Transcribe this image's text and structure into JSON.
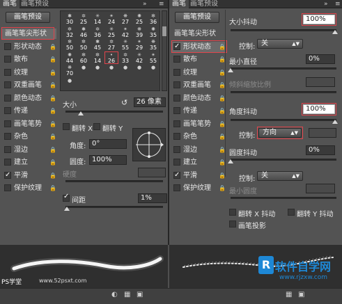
{
  "left": {
    "tabs": [
      "画笔",
      "画笔预设"
    ],
    "preset_button": "画笔预设",
    "categories": [
      {
        "label": "画笔笔尖形状",
        "checked": false,
        "lock": false,
        "selected": true
      },
      {
        "label": "形状动态",
        "checked": false,
        "lock": true
      },
      {
        "label": "散布",
        "checked": false,
        "lock": true
      },
      {
        "label": "纹理",
        "checked": false,
        "lock": true
      },
      {
        "label": "双重画笔",
        "checked": false,
        "lock": true
      },
      {
        "label": "颜色动态",
        "checked": false,
        "lock": true
      },
      {
        "label": "传递",
        "checked": false,
        "lock": true
      },
      {
        "label": "画笔笔势",
        "checked": false,
        "lock": true
      },
      {
        "label": "杂色",
        "checked": false,
        "lock": true
      },
      {
        "label": "湿边",
        "checked": false,
        "lock": true
      },
      {
        "label": "建立",
        "checked": false,
        "lock": true
      },
      {
        "label": "平滑",
        "checked": true,
        "lock": true
      },
      {
        "label": "保护纹理",
        "checked": false,
        "lock": true
      }
    ],
    "tips": [
      "30",
      "25",
      "14",
      "24",
      "27",
      "25",
      "36",
      "32",
      "46",
      "36",
      "25",
      "42",
      "39",
      "35",
      "50",
      "50",
      "45",
      "27",
      "55",
      "29",
      "35",
      "44",
      "60",
      "14",
      "26",
      "33",
      "42",
      "55",
      "70",
      "",
      "",
      "",
      "",
      "",
      "",
      ""
    ],
    "size_label": "大小",
    "size_value": "26 像素",
    "flip_x": "翻转 X",
    "flip_y": "翻转 Y",
    "angle_label": "角度:",
    "angle_value": "0°",
    "roundness_label": "圆度:",
    "roundness_value": "100%",
    "hardness_label": "硬度",
    "spacing_label": "间距",
    "spacing_checked": true,
    "spacing_value": "1%"
  },
  "right": {
    "tabs": [
      "画笔",
      "画笔预设"
    ],
    "preset_button": "画笔预设",
    "categories": [
      {
        "label": "画笔笔尖形状",
        "checked": false,
        "lock": false
      },
      {
        "label": "形状动态",
        "checked": true,
        "lock": true,
        "selected": true
      },
      {
        "label": "散布",
        "checked": false,
        "lock": true
      },
      {
        "label": "纹理",
        "checked": false,
        "lock": true
      },
      {
        "label": "双重画笔",
        "checked": false,
        "lock": true
      },
      {
        "label": "颜色动态",
        "checked": false,
        "lock": true
      },
      {
        "label": "传递",
        "checked": false,
        "lock": true
      },
      {
        "label": "画笔笔势",
        "checked": false,
        "lock": true
      },
      {
        "label": "杂色",
        "checked": false,
        "lock": true
      },
      {
        "label": "湿边",
        "checked": false,
        "lock": true
      },
      {
        "label": "建立",
        "checked": false,
        "lock": true
      },
      {
        "label": "平滑",
        "checked": true,
        "lock": true
      },
      {
        "label": "保护纹理",
        "checked": false,
        "lock": true
      }
    ],
    "size_jitter_label": "大小抖动",
    "size_jitter_value": "100%",
    "control_label": "控制:",
    "control1_value": "关",
    "min_diameter_label": "最小直径",
    "min_diameter_value": "0%",
    "tilt_scale_label": "倾斜缩放比例",
    "angle_jitter_label": "角度抖动",
    "angle_jitter_value": "100%",
    "control2_value": "方向",
    "roundness_jitter_label": "圆度抖动",
    "roundness_jitter_value": "0%",
    "control3_value": "关",
    "min_roundness_label": "最小圆度",
    "flip_x_jitter": "翻转 X 抖动",
    "flip_y_jitter": "翻转 Y 抖动",
    "brush_projection": "画笔投影"
  },
  "watermark_left": "PS学堂",
  "watermark_url": "www.52psxt.com",
  "logo_text": "软件自学网",
  "logo_url": "www.rjzxw.com"
}
